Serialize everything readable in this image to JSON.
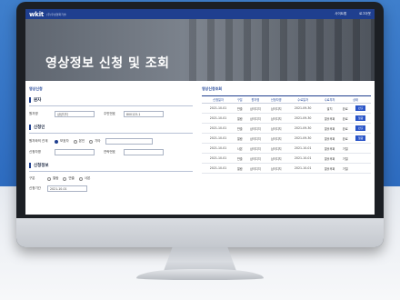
{
  "app": {
    "logo": "wkit",
    "logo_sub": "(주)우성영화기술",
    "nav": [
      "사이트맵",
      "로그아웃"
    ]
  },
  "hero": {
    "title": "영상정보 신청 및 조회"
  },
  "left": {
    "section_title": "영상신청",
    "group1": {
      "title": "원자",
      "label1": "원자명",
      "value1": "삼성디지",
      "label2": "주민번호",
      "value2": "800123-1"
    },
    "group2": {
      "title": "신청인",
      "label1": "원자와의 관계",
      "radios": [
        "보호자",
        "본인",
        "기타"
      ],
      "label2": "신청자명",
      "label3": "연락번호"
    },
    "group3": {
      "title": "신청정보",
      "label1": "구분",
      "radios": [
        "열람",
        "반출",
        "사본"
      ],
      "label2": "신청기간",
      "value2": "2021-10-01"
    }
  },
  "right": {
    "section_title": "영상신청조회",
    "columns": [
      "신청일자",
      "구분",
      "원자명",
      "신청자명",
      "수료일자",
      "수료부처",
      "상태"
    ],
    "rows": [
      [
        "2021-10-01",
        "반출",
        "삼이디지",
        "삼이디지",
        "2021-09-30",
        "발치",
        "완료",
        "반출"
      ],
      [
        "2021-10-01",
        "열람",
        "삼이디지",
        "삼이디지",
        "2021-09-30",
        "열흘후회",
        "완료",
        "열람"
      ],
      [
        "2021-10-01",
        "반출",
        "삼이디지",
        "삼이디지",
        "2021-09-30",
        "열흘후회",
        "완료",
        "반출"
      ],
      [
        "2021-10-01",
        "열람",
        "삼이디지",
        "삼이디지",
        "2021-09-30",
        "열흘후회",
        "완료",
        "열람"
      ],
      [
        "2021-10-01",
        "사본",
        "삼이디지",
        "삼이디지",
        "2021-10-01",
        "열흘후회",
        "거절",
        ""
      ],
      [
        "2021-10-01",
        "반출",
        "삼이디지",
        "삼이디지",
        "2021-10-01",
        "열흘후회",
        "거절",
        ""
      ],
      [
        "2021-10-01",
        "열람",
        "삼이디지",
        "삼이디지",
        "2021-10-01",
        "열흘후회",
        "거절",
        ""
      ]
    ]
  }
}
